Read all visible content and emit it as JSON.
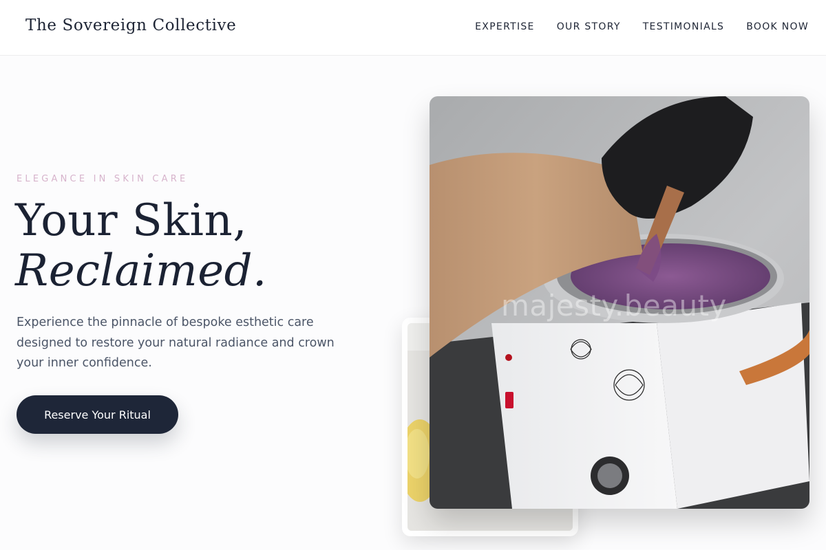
{
  "header": {
    "brand": "The Sovereign Collective",
    "nav": [
      "EXPERTISE",
      "OUR STORY",
      "TESTIMONIALS",
      "BOOK NOW"
    ]
  },
  "hero": {
    "eyebrow": "ELEGANCE IN SKIN CARE",
    "headline_line1": "Your Skin,",
    "headline_line2": "Reclaimed.",
    "description": "Experience the pinnacle of bespoke esthetic care designed to restore your natural radiance and crown your inner confidence.",
    "cta_label": "Reserve Your Ritual"
  },
  "images": {
    "main_watermark": "majesty.beauty"
  },
  "colors": {
    "navy": "#1e2638",
    "eyebrow_pink": "#d7b4cc",
    "body_text": "#4b5567",
    "background": "#fcfcfd"
  }
}
